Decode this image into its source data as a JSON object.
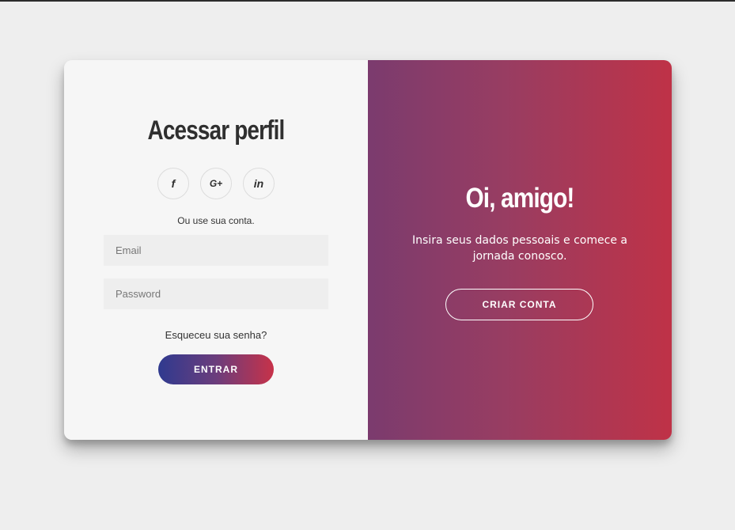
{
  "login": {
    "title": "Acessar perfil",
    "socials": [
      {
        "icon": "facebook-icon",
        "glyph": "f"
      },
      {
        "icon": "google-plus-icon",
        "glyph": "G+"
      },
      {
        "icon": "linkedin-icon",
        "glyph": "in"
      }
    ],
    "subtext": "Ou use sua conta.",
    "email_placeholder": "Email",
    "password_placeholder": "Password",
    "forgot_label": "Esqueceu sua senha?",
    "submit_label": "ENTRAR"
  },
  "signup_panel": {
    "title": "Oi, amigo!",
    "text": "Insira seus dados pessoais e comece a jornada conosco.",
    "button_label": "CRIAR CONTA"
  },
  "colors": {
    "background": "#eeeeee",
    "panel_gradient_start": "#7b3b6e",
    "panel_gradient_end": "#bf3247",
    "button_gradient_start": "#2f3a8f",
    "button_gradient_end": "#c73249"
  }
}
